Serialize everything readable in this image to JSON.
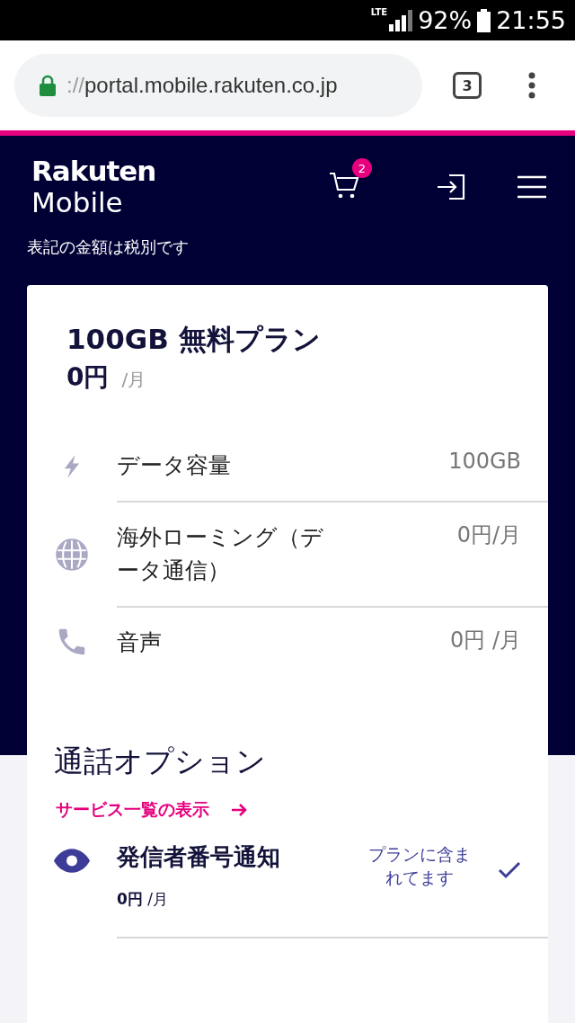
{
  "status_bar": {
    "network": "LTE",
    "battery": "92%",
    "time": "21:55"
  },
  "browser": {
    "url_scheme": "://",
    "url_host": "portal.mobile.rakuten.co.jp",
    "tab_count": "3"
  },
  "header": {
    "logo_top": "Rakuten",
    "logo_bottom": "Mobile",
    "cart_count": "2",
    "tax_note": "表記の金額は税別です"
  },
  "plan": {
    "title": "100GB 無料プラン",
    "price": "0円",
    "per": "/月",
    "features": [
      {
        "kind": "bolt",
        "label": "データ容量",
        "value": "100GB"
      },
      {
        "kind": "globe",
        "label": "海外ローミング（データ通信）",
        "value": "0円/月"
      },
      {
        "kind": "phone",
        "label": "音声",
        "value": "0円 /月"
      }
    ]
  },
  "options": {
    "title": "通話オプション",
    "link": "サービス一覧の表示",
    "items": [
      {
        "kind": "eye",
        "name": "発信者番号通知",
        "price": "**0円** /月",
        "status": "プランに含まれてます",
        "included": true
      }
    ]
  }
}
